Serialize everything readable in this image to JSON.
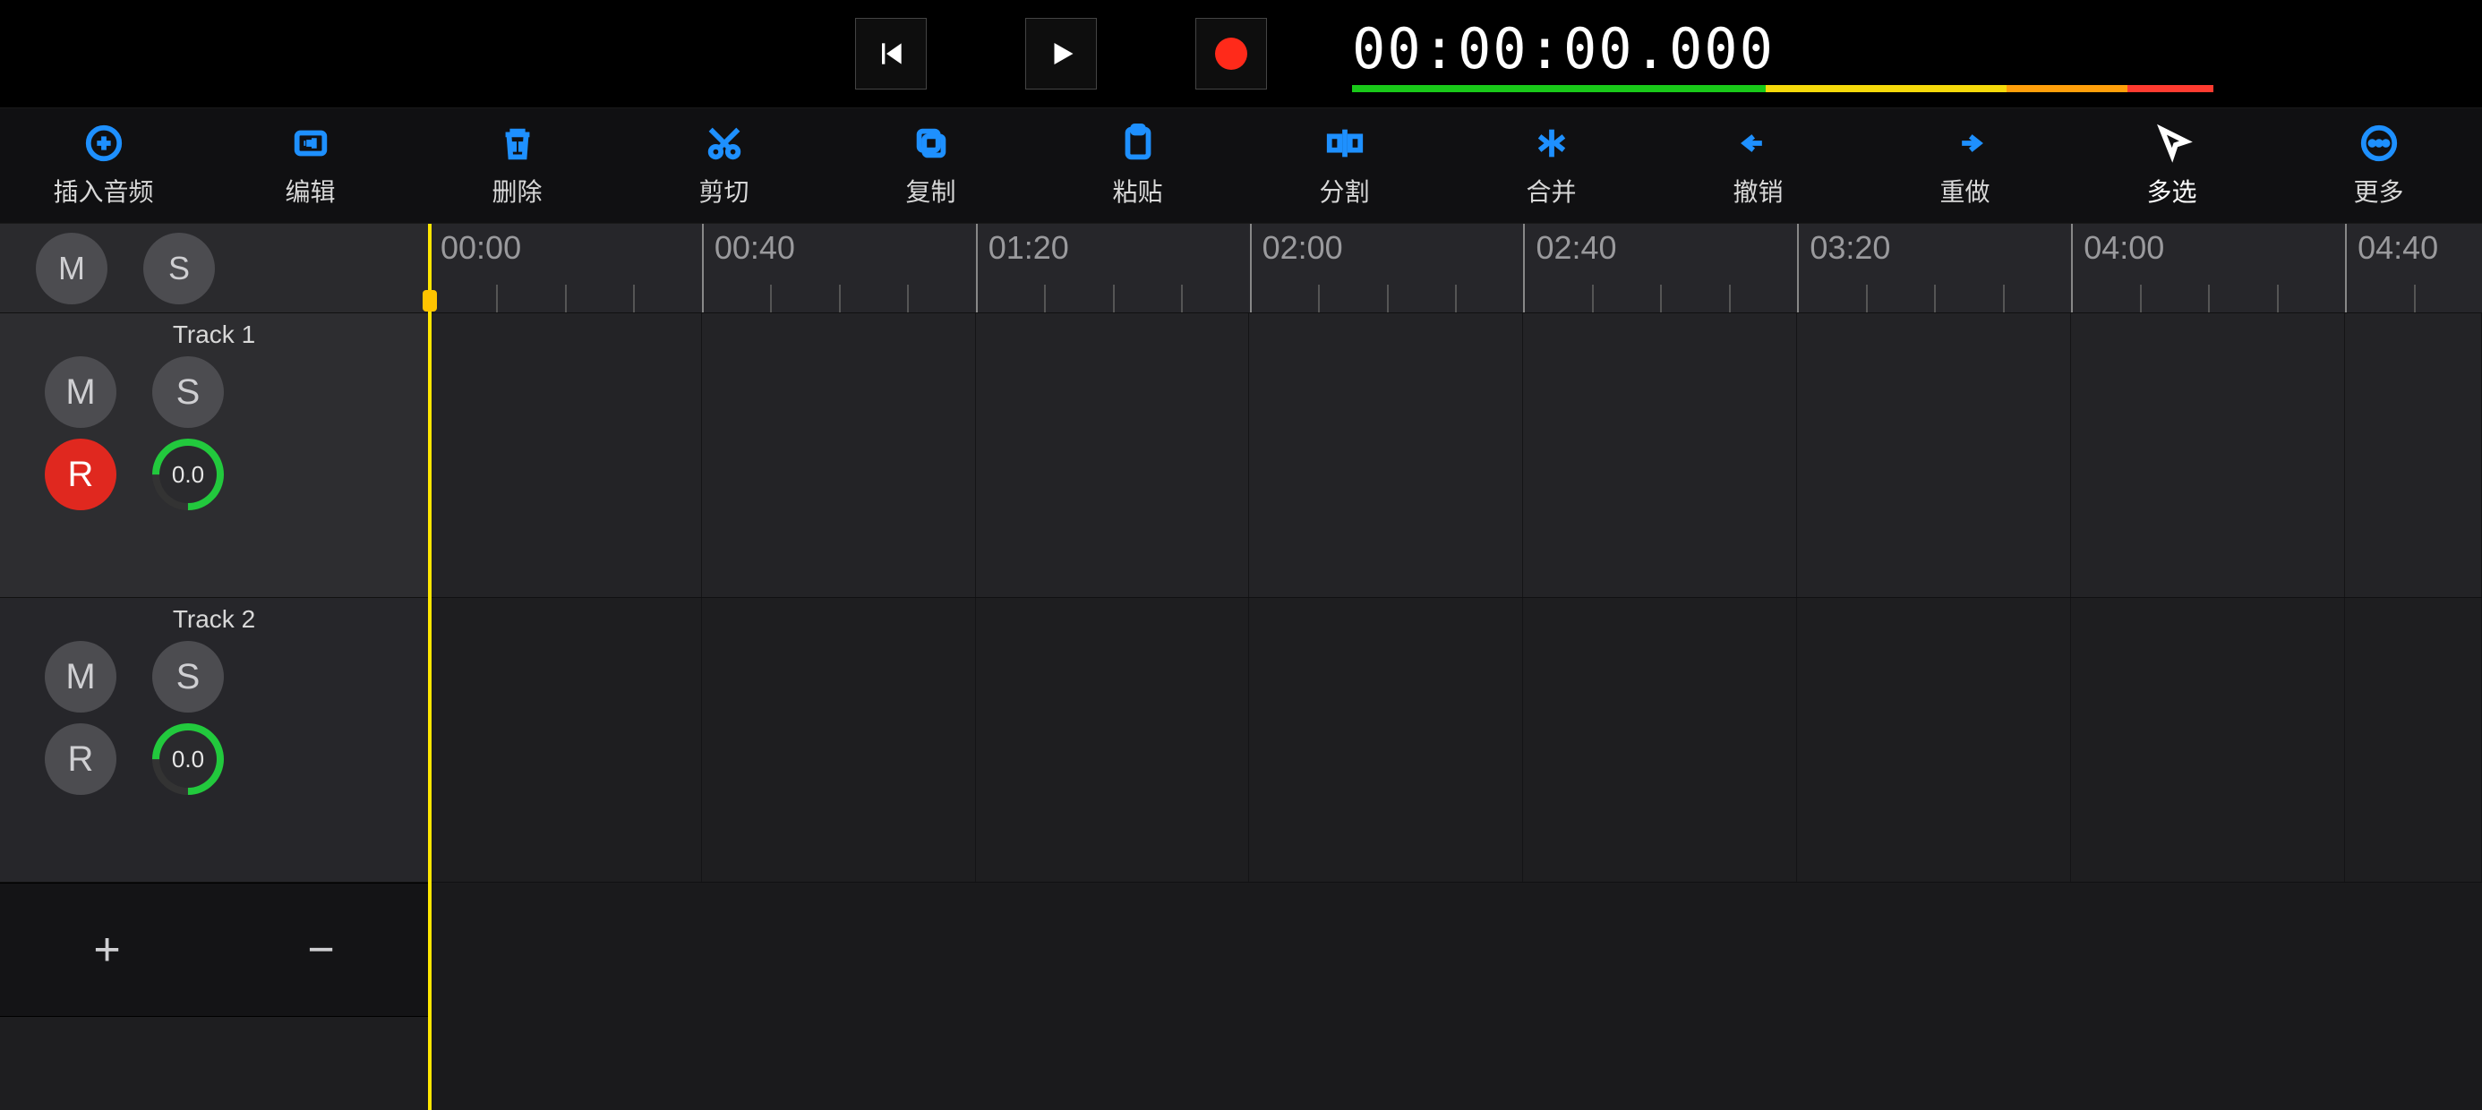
{
  "transport": {
    "time": "00:00:00.000"
  },
  "actions": {
    "insert": "插入音频",
    "edit": "编辑",
    "delete": "删除",
    "cut": "剪切",
    "copy": "复制",
    "paste": "粘贴",
    "split": "分割",
    "merge": "合并",
    "undo": "撤销",
    "redo": "重做",
    "multiselect": "多选",
    "more": "更多"
  },
  "master": {
    "mute": "M",
    "solo": "S"
  },
  "tracks": [
    {
      "name": "Track 1",
      "mute": "M",
      "solo": "S",
      "rec": "R",
      "gain": "0.0",
      "rec_armed": true
    },
    {
      "name": "Track 2",
      "mute": "M",
      "solo": "S",
      "rec": "R",
      "gain": "0.0",
      "rec_armed": false
    }
  ],
  "ruler": {
    "labels": [
      "00:00",
      "00:40",
      "01:20",
      "02:00",
      "02:40",
      "03:20",
      "04:00",
      "04:40"
    ]
  },
  "footer": {
    "add": "+",
    "remove": "−"
  }
}
